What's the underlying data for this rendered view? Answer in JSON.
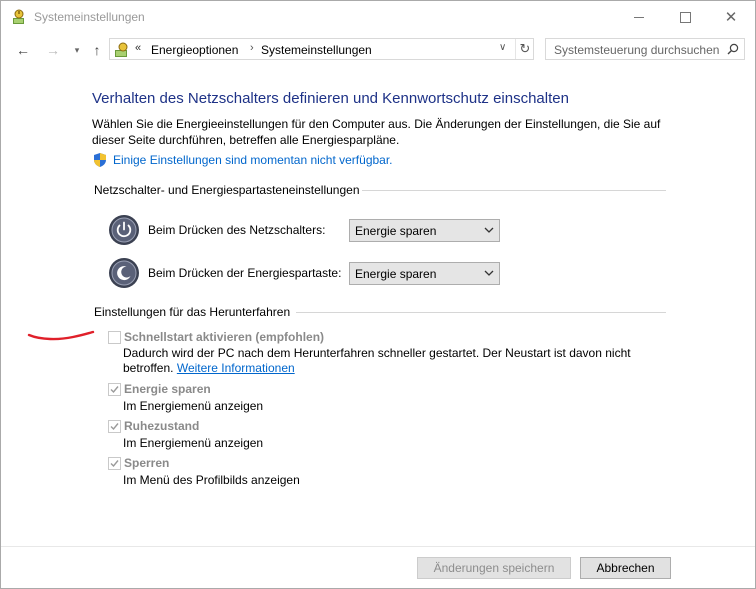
{
  "window": {
    "title": "Systemeinstellungen"
  },
  "nav": {
    "breadcrumbs": [
      "Energieoptionen",
      "Systemeinstellungen"
    ],
    "crumb_prefix": "«",
    "search_placeholder": "Systemsteuerung durchsuchen"
  },
  "main": {
    "title": "Verhalten des Netzschalters definieren und Kennwortschutz einschalten",
    "intro": "Wählen Sie die Energieeinstellungen für den Computer aus. Die Änderungen der Einstellungen, die Sie auf dieser Seite durchführen, betreffen alle Energiesparpläne.",
    "change_link": "Einige Einstellungen sind momentan nicht verfügbar.",
    "power_group": {
      "heading": "Netzschalter- und Energiespartasteneinstellungen",
      "rows": [
        {
          "label": "Beim Drücken des Netzschalters:",
          "value": "Energie sparen"
        },
        {
          "label": "Beim Drücken der Energiespartaste:",
          "value": "Energie sparen"
        }
      ]
    },
    "shutdown_group": {
      "heading": "Einstellungen für das Herunterfahren",
      "options": [
        {
          "label": "Schnellstart aktivieren (empfohlen)",
          "checked": false,
          "desc": "Dadurch wird der PC nach dem Herunterfahren schneller gestartet. Der Neustart ist davon nicht betroffen.",
          "link": "Weitere Informationen"
        },
        {
          "label": "Energie sparen",
          "checked": true,
          "desc": "Im Energiemenü anzeigen"
        },
        {
          "label": "Ruhezustand",
          "checked": true,
          "desc": "Im Energiemenü anzeigen"
        },
        {
          "label": "Sperren",
          "checked": true,
          "desc": "Im Menü des Profilbilds anzeigen"
        }
      ]
    }
  },
  "footer": {
    "save_label": "Änderungen speichern",
    "cancel_label": "Abbrechen"
  },
  "colors": {
    "title": "#1e3287",
    "link": "#0066cc",
    "annotation": "#e0202a",
    "disabled_text": "#8a8a8a"
  }
}
